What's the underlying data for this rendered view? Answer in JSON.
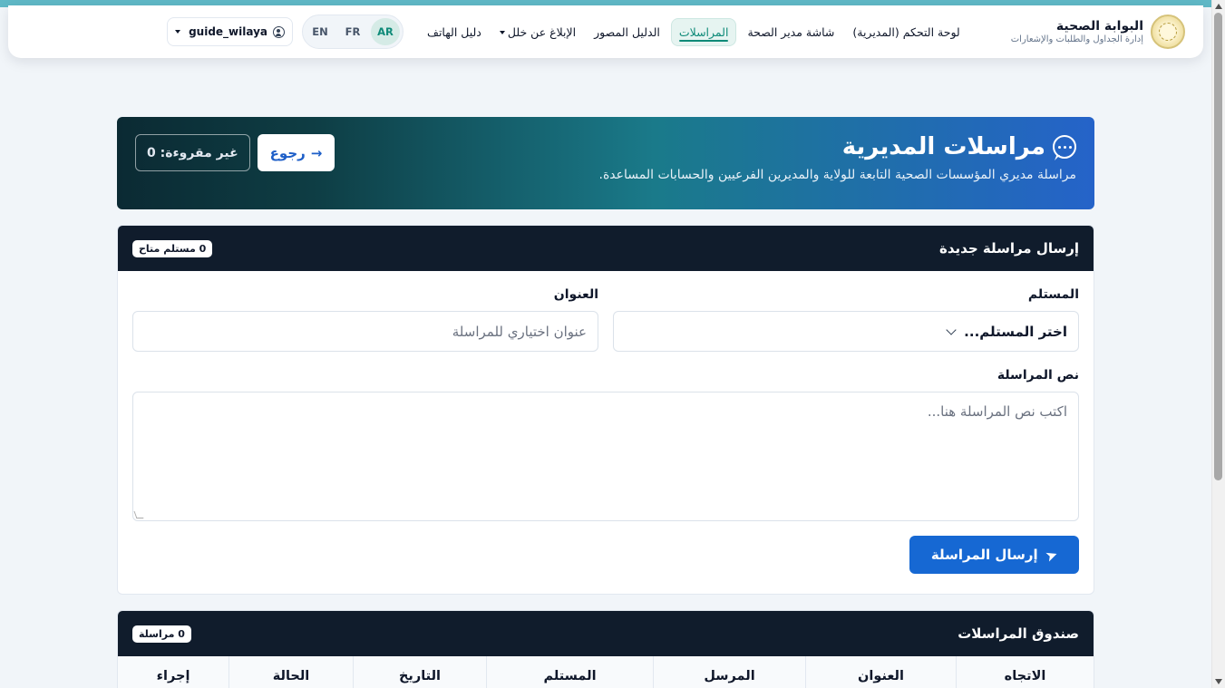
{
  "brand": {
    "title": "البوابة الصحية",
    "subtitle": "إدارة الجداول والطلبات والإشعارات"
  },
  "nav": {
    "items": [
      {
        "label": "لوحة التحكم (المديرية)",
        "active": false
      },
      {
        "label": "شاشة مدير الصحة",
        "active": false
      },
      {
        "label": "المراسلات",
        "active": true
      },
      {
        "label": "الدليل المصور",
        "active": false
      },
      {
        "label": "الإبلاغ عن خلل",
        "active": false,
        "dropdown": true
      },
      {
        "label": "دليل الهاتف",
        "active": false
      }
    ],
    "languages": [
      "AR",
      "FR",
      "EN"
    ],
    "active_language": "AR",
    "user": "guide_wilaya"
  },
  "hero": {
    "title": "مراسلات المديرية",
    "description": "مراسلة مديري المؤسسات الصحية التابعة للولاية والمديرين الفرعيين والحسابات المساعدة.",
    "back_label": "رجوع",
    "unread_label": "غير مقروءة: 0"
  },
  "compose": {
    "title": "إرسال مراسلة جديدة",
    "available_badge": "0 مستلم متاح",
    "recipient_label": "المستلم",
    "recipient_value": "اختر المستلم...",
    "subject_label": "العنوان",
    "subject_placeholder": "عنوان اختياري للمراسلة",
    "body_label": "نص المراسلة",
    "body_placeholder": "اكتب نص المراسلة هنا...",
    "send_label": "إرسال المراسلة"
  },
  "inbox": {
    "title": "صندوق المراسلات",
    "count_badge": "0 مراسلة",
    "columns": [
      "الاتجاه",
      "العنوان",
      "المرسل",
      "المستلم",
      "التاريخ",
      "الحالة",
      "إجراء"
    ]
  },
  "colors": {
    "accent": "#0e8a78",
    "primary": "#1668d3",
    "header_dark": "#101c2c"
  }
}
